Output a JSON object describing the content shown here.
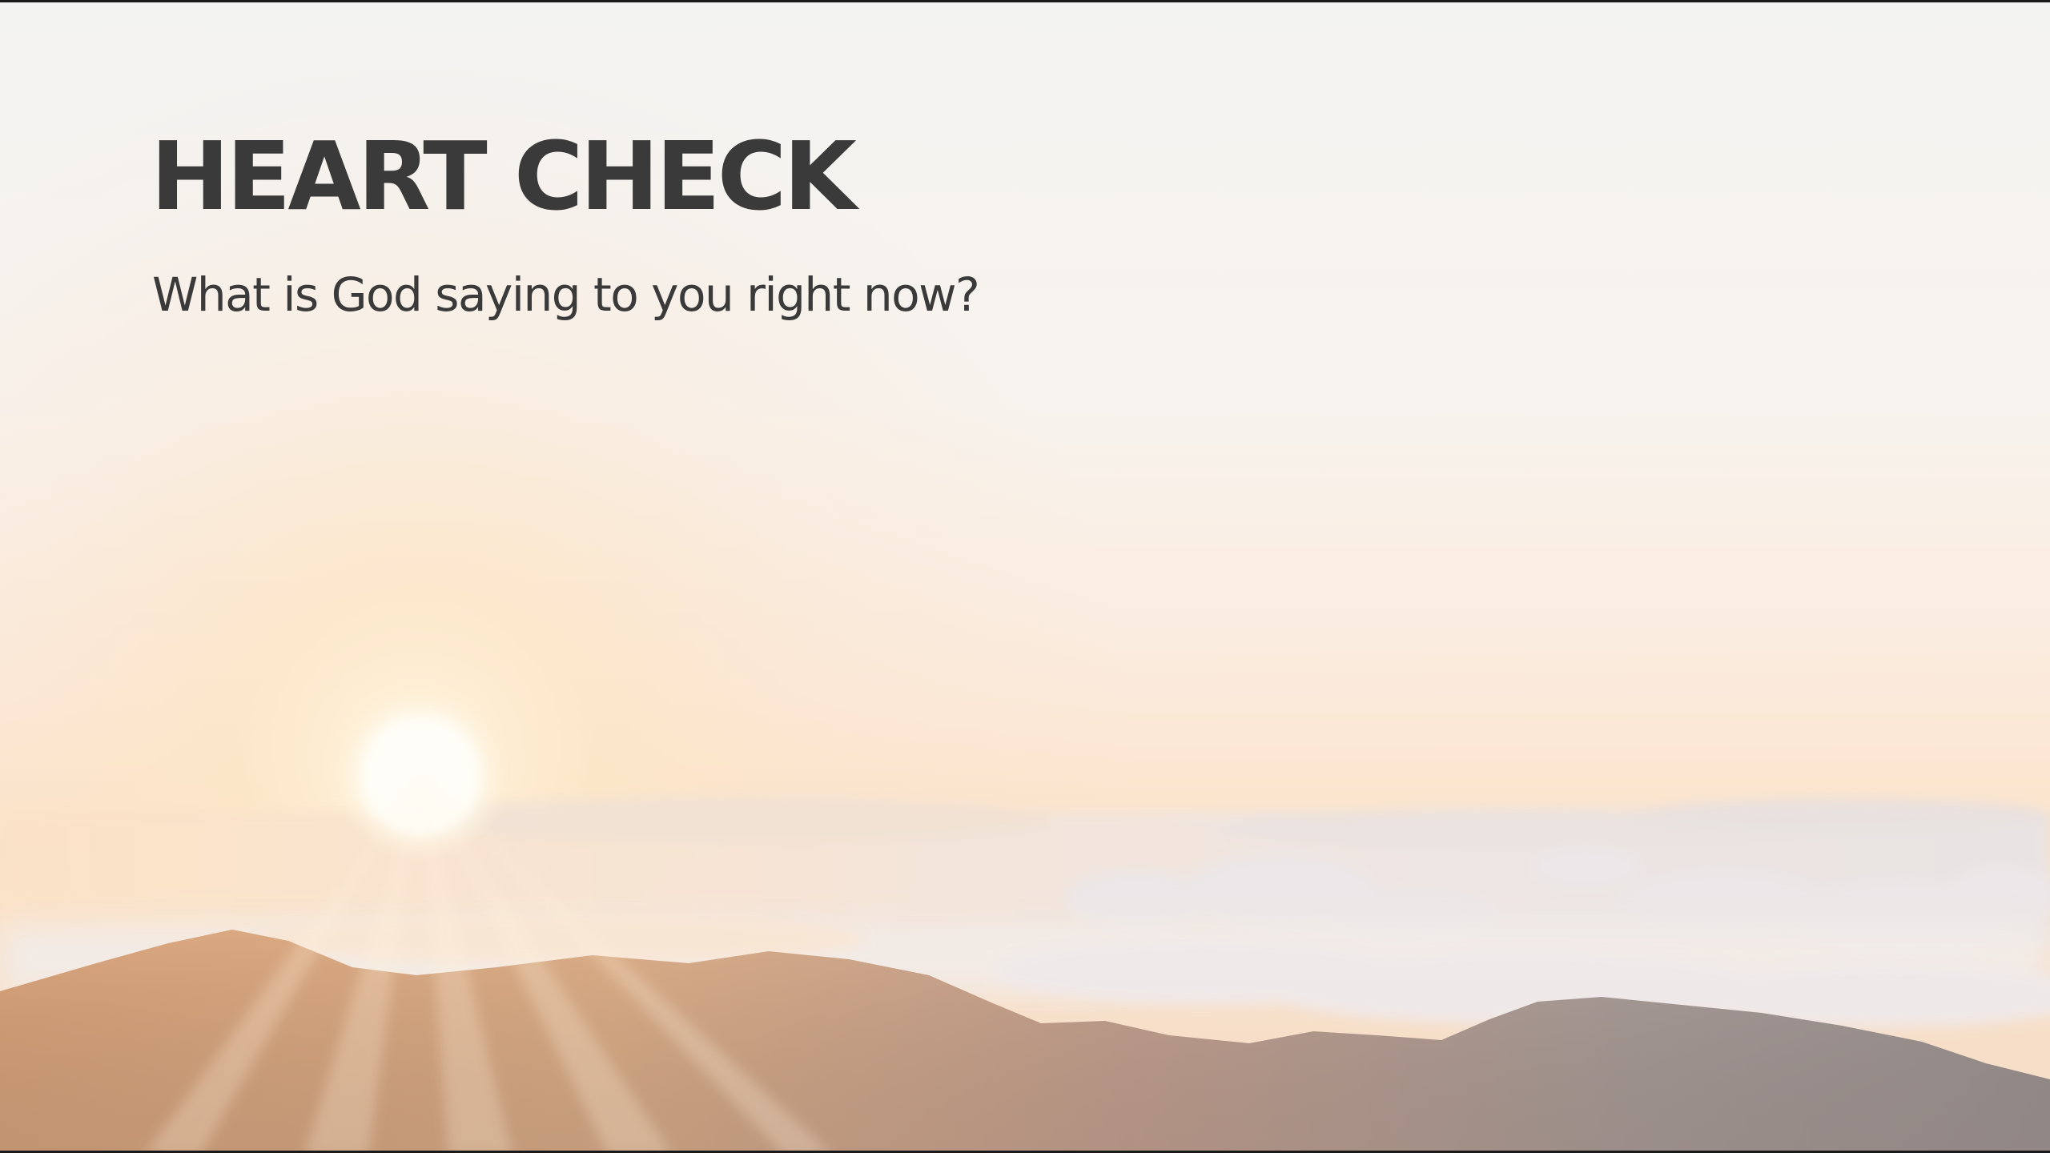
{
  "slide": {
    "title": "HEART CHECK",
    "subtitle": "What is God saying to you right now?"
  },
  "background": {
    "description_icon": "sunrise-over-clouds-photo",
    "colors": {
      "sky_top": "#f2f2f1",
      "sky_mid": "#fbeee1",
      "horizon": "#fbe0c2",
      "sun": "#fffaf0",
      "clouds": "#eeeaea",
      "mountains_warm": "#dcab84",
      "mountains_cool": "#a69c98",
      "text": "#3a3a3a"
    }
  }
}
